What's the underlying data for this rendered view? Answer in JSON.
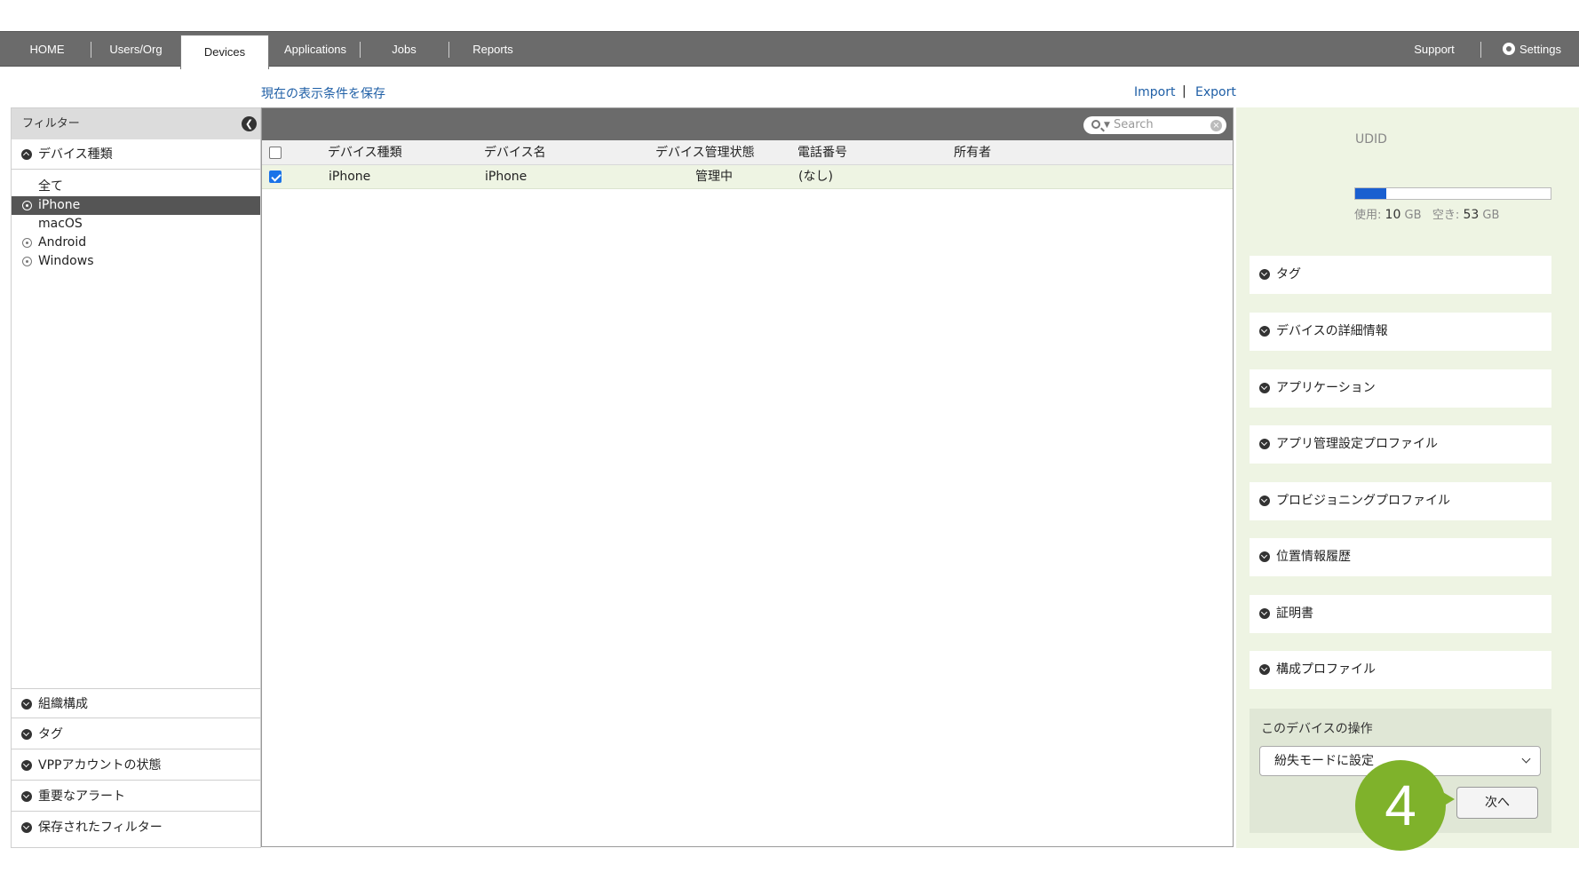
{
  "nav": {
    "home": "HOME",
    "users_org": "Users/Org",
    "devices": "Devices",
    "applications": "Applications",
    "jobs": "Jobs",
    "reports": "Reports",
    "support": "Support",
    "settings": "Settings"
  },
  "toolbar": {
    "save_view": "現在の表示条件を保存",
    "import": "Import",
    "separator": "|",
    "export": "Export"
  },
  "filter": {
    "header": "フィルター",
    "device_type_label": "デバイス種類",
    "device_types": [
      "全て",
      "iPhone",
      "macOS",
      "Android",
      "Windows"
    ],
    "selected_device_type": "iPhone",
    "sections": [
      "組織構成",
      "タグ",
      "VPPアカウントの状態",
      "重要なアラート",
      "保存されたフィルター"
    ]
  },
  "search": {
    "placeholder": "Search"
  },
  "table": {
    "columns": [
      "デバイス種類",
      "デバイス名",
      "デバイス管理状態",
      "電話番号",
      "所有者"
    ],
    "rows": [
      {
        "checked": true,
        "device_type": "iPhone",
        "device_name": "iPhone",
        "status": "管理中",
        "phone": "(なし)",
        "owner": ""
      }
    ]
  },
  "detail": {
    "udid_label": "UDID",
    "storage": {
      "used_label": "使用:",
      "used_value": "10",
      "free_label": "空き:",
      "free_value": "53",
      "unit": "GB",
      "used_fraction": 0.16
    },
    "sections": [
      "タグ",
      "デバイスの詳細情報",
      "アプリケーション",
      "アプリ管理設定プロファイル",
      "プロビジョニングプロファイル",
      "位置情報履歴",
      "証明書",
      "構成プロファイル"
    ],
    "operations": {
      "title": "このデバイスの操作",
      "selected_action": "紛失モードに設定",
      "next_label": "次へ"
    }
  },
  "step_badge": "4",
  "colors": {
    "nav_bg": "#6b6b6b",
    "link": "#1f5fa6",
    "right_panel_bg": "#eef4e3",
    "badge": "#7fb22b",
    "storage_fill": "#1a5fd0"
  }
}
